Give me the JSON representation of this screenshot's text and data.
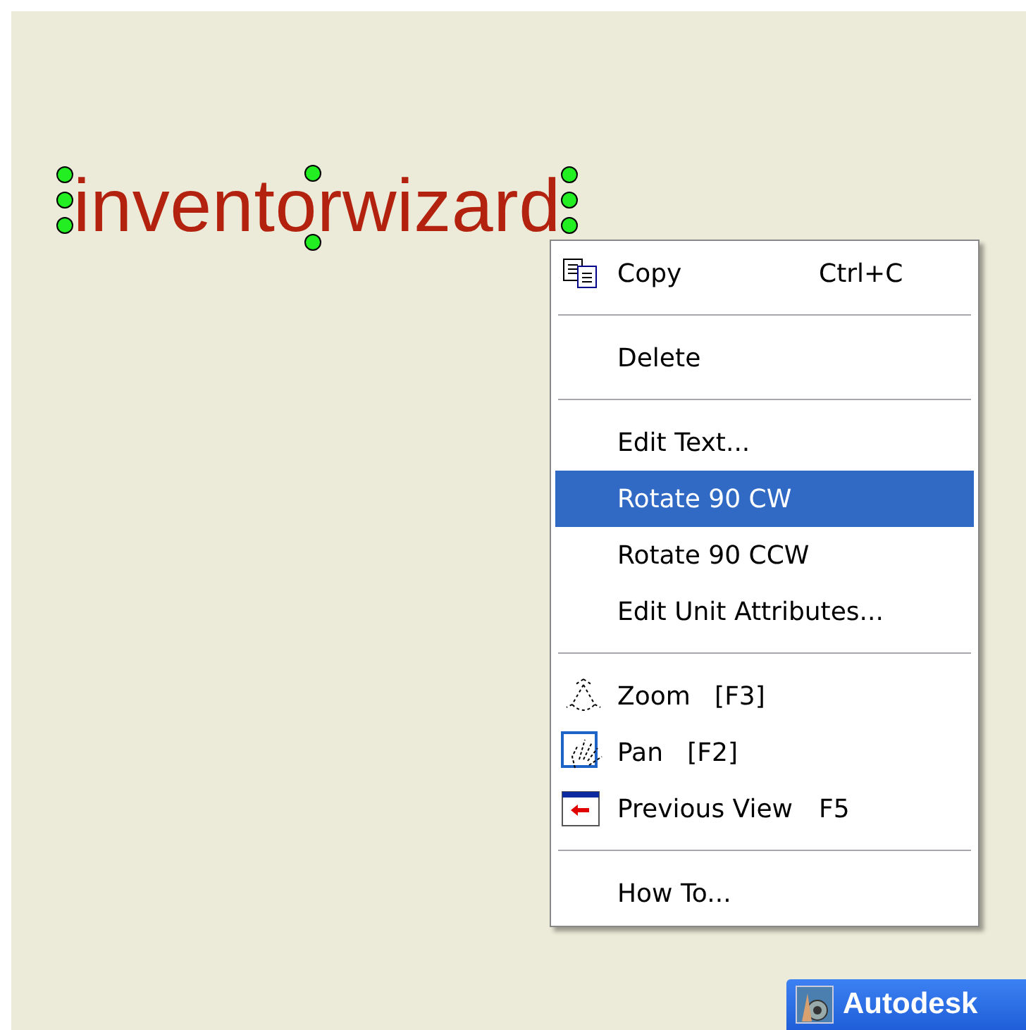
{
  "canvas": {
    "label": "inventorwizard",
    "selected": true
  },
  "context_menu": {
    "items": [
      {
        "kind": "copy",
        "label": "Copy",
        "shortcut": "Ctrl+C",
        "selected": false
      },
      {
        "kind": "separator"
      },
      {
        "kind": "text",
        "label": "Delete",
        "selected": false
      },
      {
        "kind": "separator"
      },
      {
        "kind": "text",
        "label": "Edit Text...",
        "selected": false
      },
      {
        "kind": "text",
        "label": "Rotate 90 CW",
        "selected": true
      },
      {
        "kind": "text",
        "label": "Rotate 90 CCW",
        "selected": false
      },
      {
        "kind": "text",
        "label": "Edit Unit Attributes...",
        "selected": false
      },
      {
        "kind": "separator"
      },
      {
        "kind": "zoom",
        "label": "Zoom   [F3]",
        "selected": false
      },
      {
        "kind": "pan",
        "label": "Pan   [F2]",
        "selected": false
      },
      {
        "kind": "previous",
        "label": "Previous View",
        "shortcut": "F5",
        "selected": false
      },
      {
        "kind": "separator"
      },
      {
        "kind": "text",
        "label": "How To...",
        "selected": false
      }
    ]
  },
  "taskbar_button": {
    "label": "Autodesk"
  }
}
